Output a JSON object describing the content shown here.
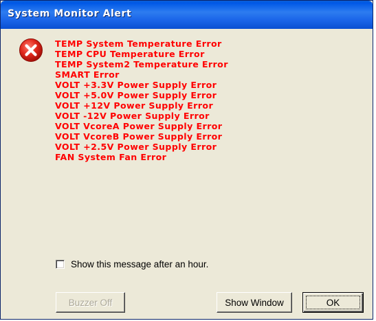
{
  "window": {
    "title": "System Monitor Alert"
  },
  "icon": {
    "name": "error-icon",
    "color": "#d9231c"
  },
  "messages": [
    "TEMP System Temperature Error",
    "TEMP CPU Temperature Error",
    "TEMP System2 Temperature Error",
    "SMART Error",
    "VOLT +3.3V Power Supply Error",
    "VOLT +5.0V Power Supply Error",
    "VOLT +12V Power Supply Error",
    "VOLT -12V Power Supply Error",
    "VOLT VcoreA Power Supply Error",
    "VOLT VcoreB Power Supply Error",
    "VOLT +2.5V Power Supply Error",
    "FAN System Fan Error"
  ],
  "message_color": "#ff0000",
  "checkbox": {
    "label": "Show this message after an hour.",
    "checked": false
  },
  "buttons": {
    "buzzer_off": "Buzzer Off",
    "show_window": "Show Window",
    "ok": "OK"
  }
}
